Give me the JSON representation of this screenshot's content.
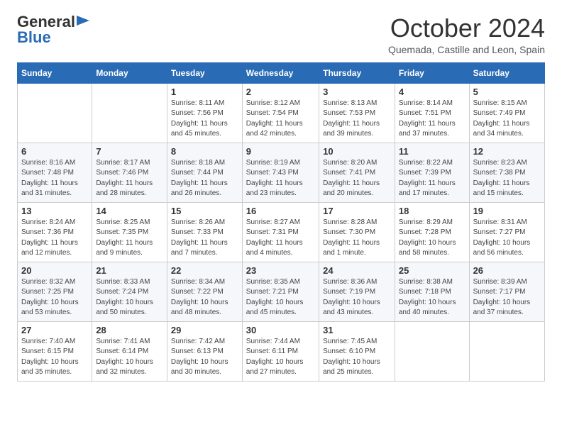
{
  "header": {
    "logo_general": "General",
    "logo_blue": "Blue",
    "month_title": "October 2024",
    "location": "Quemada, Castille and Leon, Spain"
  },
  "days_of_week": [
    "Sunday",
    "Monday",
    "Tuesday",
    "Wednesday",
    "Thursday",
    "Friday",
    "Saturday"
  ],
  "weeks": [
    [
      {
        "day": "",
        "detail": ""
      },
      {
        "day": "",
        "detail": ""
      },
      {
        "day": "1",
        "detail": "Sunrise: 8:11 AM\nSunset: 7:56 PM\nDaylight: 11 hours and 45 minutes."
      },
      {
        "day": "2",
        "detail": "Sunrise: 8:12 AM\nSunset: 7:54 PM\nDaylight: 11 hours and 42 minutes."
      },
      {
        "day": "3",
        "detail": "Sunrise: 8:13 AM\nSunset: 7:53 PM\nDaylight: 11 hours and 39 minutes."
      },
      {
        "day": "4",
        "detail": "Sunrise: 8:14 AM\nSunset: 7:51 PM\nDaylight: 11 hours and 37 minutes."
      },
      {
        "day": "5",
        "detail": "Sunrise: 8:15 AM\nSunset: 7:49 PM\nDaylight: 11 hours and 34 minutes."
      }
    ],
    [
      {
        "day": "6",
        "detail": "Sunrise: 8:16 AM\nSunset: 7:48 PM\nDaylight: 11 hours and 31 minutes."
      },
      {
        "day": "7",
        "detail": "Sunrise: 8:17 AM\nSunset: 7:46 PM\nDaylight: 11 hours and 28 minutes."
      },
      {
        "day": "8",
        "detail": "Sunrise: 8:18 AM\nSunset: 7:44 PM\nDaylight: 11 hours and 26 minutes."
      },
      {
        "day": "9",
        "detail": "Sunrise: 8:19 AM\nSunset: 7:43 PM\nDaylight: 11 hours and 23 minutes."
      },
      {
        "day": "10",
        "detail": "Sunrise: 8:20 AM\nSunset: 7:41 PM\nDaylight: 11 hours and 20 minutes."
      },
      {
        "day": "11",
        "detail": "Sunrise: 8:22 AM\nSunset: 7:39 PM\nDaylight: 11 hours and 17 minutes."
      },
      {
        "day": "12",
        "detail": "Sunrise: 8:23 AM\nSunset: 7:38 PM\nDaylight: 11 hours and 15 minutes."
      }
    ],
    [
      {
        "day": "13",
        "detail": "Sunrise: 8:24 AM\nSunset: 7:36 PM\nDaylight: 11 hours and 12 minutes."
      },
      {
        "day": "14",
        "detail": "Sunrise: 8:25 AM\nSunset: 7:35 PM\nDaylight: 11 hours and 9 minutes."
      },
      {
        "day": "15",
        "detail": "Sunrise: 8:26 AM\nSunset: 7:33 PM\nDaylight: 11 hours and 7 minutes."
      },
      {
        "day": "16",
        "detail": "Sunrise: 8:27 AM\nSunset: 7:31 PM\nDaylight: 11 hours and 4 minutes."
      },
      {
        "day": "17",
        "detail": "Sunrise: 8:28 AM\nSunset: 7:30 PM\nDaylight: 11 hours and 1 minute."
      },
      {
        "day": "18",
        "detail": "Sunrise: 8:29 AM\nSunset: 7:28 PM\nDaylight: 10 hours and 58 minutes."
      },
      {
        "day": "19",
        "detail": "Sunrise: 8:31 AM\nSunset: 7:27 PM\nDaylight: 10 hours and 56 minutes."
      }
    ],
    [
      {
        "day": "20",
        "detail": "Sunrise: 8:32 AM\nSunset: 7:25 PM\nDaylight: 10 hours and 53 minutes."
      },
      {
        "day": "21",
        "detail": "Sunrise: 8:33 AM\nSunset: 7:24 PM\nDaylight: 10 hours and 50 minutes."
      },
      {
        "day": "22",
        "detail": "Sunrise: 8:34 AM\nSunset: 7:22 PM\nDaylight: 10 hours and 48 minutes."
      },
      {
        "day": "23",
        "detail": "Sunrise: 8:35 AM\nSunset: 7:21 PM\nDaylight: 10 hours and 45 minutes."
      },
      {
        "day": "24",
        "detail": "Sunrise: 8:36 AM\nSunset: 7:19 PM\nDaylight: 10 hours and 43 minutes."
      },
      {
        "day": "25",
        "detail": "Sunrise: 8:38 AM\nSunset: 7:18 PM\nDaylight: 10 hours and 40 minutes."
      },
      {
        "day": "26",
        "detail": "Sunrise: 8:39 AM\nSunset: 7:17 PM\nDaylight: 10 hours and 37 minutes."
      }
    ],
    [
      {
        "day": "27",
        "detail": "Sunrise: 7:40 AM\nSunset: 6:15 PM\nDaylight: 10 hours and 35 minutes."
      },
      {
        "day": "28",
        "detail": "Sunrise: 7:41 AM\nSunset: 6:14 PM\nDaylight: 10 hours and 32 minutes."
      },
      {
        "day": "29",
        "detail": "Sunrise: 7:42 AM\nSunset: 6:13 PM\nDaylight: 10 hours and 30 minutes."
      },
      {
        "day": "30",
        "detail": "Sunrise: 7:44 AM\nSunset: 6:11 PM\nDaylight: 10 hours and 27 minutes."
      },
      {
        "day": "31",
        "detail": "Sunrise: 7:45 AM\nSunset: 6:10 PM\nDaylight: 10 hours and 25 minutes."
      },
      {
        "day": "",
        "detail": ""
      },
      {
        "day": "",
        "detail": ""
      }
    ]
  ]
}
